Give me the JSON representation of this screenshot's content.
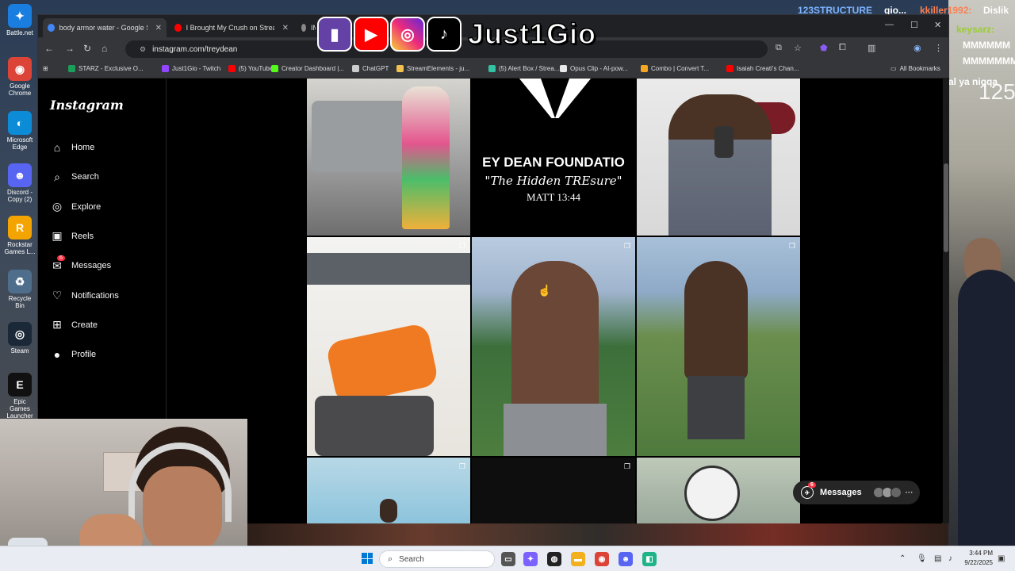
{
  "desktop": {
    "icons": [
      {
        "label": "Battle.net",
        "glyph": "✦",
        "color": "#1a7de0"
      },
      {
        "label": "Google Chrome",
        "glyph": "◉",
        "color": "#db4437"
      },
      {
        "label": "Microsoft Edge",
        "glyph": "◐",
        "color": "#0c8bd6"
      },
      {
        "label": "Discord - Copy (2)",
        "glyph": "☻",
        "color": "#5865f2"
      },
      {
        "label": "Rockstar Games L...",
        "glyph": "R",
        "color": "#f4a400"
      },
      {
        "label": "Recycle Bin",
        "glyph": "♻",
        "color": "#4f6e8c"
      },
      {
        "label": "Steam",
        "glyph": "◎",
        "color": "#1b2838"
      },
      {
        "label": "Epic Games Launcher",
        "glyph": "E",
        "color": "#111111"
      }
    ]
  },
  "stream": {
    "channel_name": "Just1Gio",
    "right_number": "125",
    "chat_lines": [
      {
        "text": "123STRUCTURE",
        "color": "#7db3ff"
      },
      {
        "text": "gio...",
        "color": "#ffffff"
      },
      {
        "text": "kkiller1992:",
        "color": "#ff7f50"
      },
      {
        "text": "Dislik",
        "color": "#ffffff"
      },
      {
        "text": "keysarz:",
        "color": "#9acd32"
      },
      {
        "text": "MMMMMM",
        "color": "#ffffff"
      },
      {
        "text": "MMMMMMM",
        "color": "#ffffff"
      },
      {
        "text": "al ya niqqa",
        "color": "#ffffff"
      }
    ]
  },
  "browser": {
    "tabs": [
      {
        "title": "body armor water - Google Se...",
        "fav_color": "#4285f4",
        "active": true
      },
      {
        "title": "I Brought My Crush on Stream...",
        "fav_color": "#ff0000",
        "active": false
      },
      {
        "title": "IM",
        "fav_color": "#888888",
        "active": false
      }
    ],
    "url": "instagram.com/treydean",
    "bookmarks": [
      {
        "label": "STARZ - Exclusive O...",
        "color": "#1a9e5a"
      },
      {
        "label": "Just1Gio - Twitch",
        "color": "#9146ff"
      },
      {
        "label": "(5) YouTube",
        "color": "#ff0000"
      },
      {
        "label": "Creator Dashboard |...",
        "color": "#53fc18"
      },
      {
        "label": "ChatGPT",
        "color": "#cccccc"
      },
      {
        "label": "StreamElements - ju...",
        "color": "#f2c14e"
      },
      {
        "label": "(5) Alert Box / Strea...",
        "color": "#31c3a2"
      },
      {
        "label": "Opus Clip - AI-pow...",
        "color": "#e8e8e8"
      },
      {
        "label": "Combo | Convert T...",
        "color": "#f5a623"
      },
      {
        "label": "Isaiah Creati's Chan...",
        "color": "#ff0000"
      }
    ],
    "all_bookmarks": "All Bookmarks"
  },
  "instagram": {
    "logo": "Instagram",
    "nav": [
      {
        "label": "Home",
        "icon": "⌂",
        "icon_name": "home-icon"
      },
      {
        "label": "Search",
        "icon": "⌕",
        "icon_name": "search-icon"
      },
      {
        "label": "Explore",
        "icon": "◎",
        "icon_name": "explore-icon"
      },
      {
        "label": "Reels",
        "icon": "▣",
        "icon_name": "reels-icon"
      },
      {
        "label": "Messages",
        "icon": "✉",
        "icon_name": "messages-icon",
        "badge": "6"
      },
      {
        "label": "Notifications",
        "icon": "♡",
        "icon_name": "heart-icon"
      },
      {
        "label": "Create",
        "icon": "⊞",
        "icon_name": "create-icon"
      },
      {
        "label": "Profile",
        "icon": "●",
        "icon_name": "profile-avatar-icon"
      }
    ],
    "post_text": {
      "line1": "EY DEAN FOUNDATIO",
      "line2": "\"The Hidden TREsure\"",
      "line3": "MATT 13:44"
    },
    "messages_float": {
      "label": "Messages",
      "badge": "6"
    }
  },
  "taskbar": {
    "search_placeholder": "Search",
    "time": "3:44 PM",
    "date": "9/22/2025"
  }
}
